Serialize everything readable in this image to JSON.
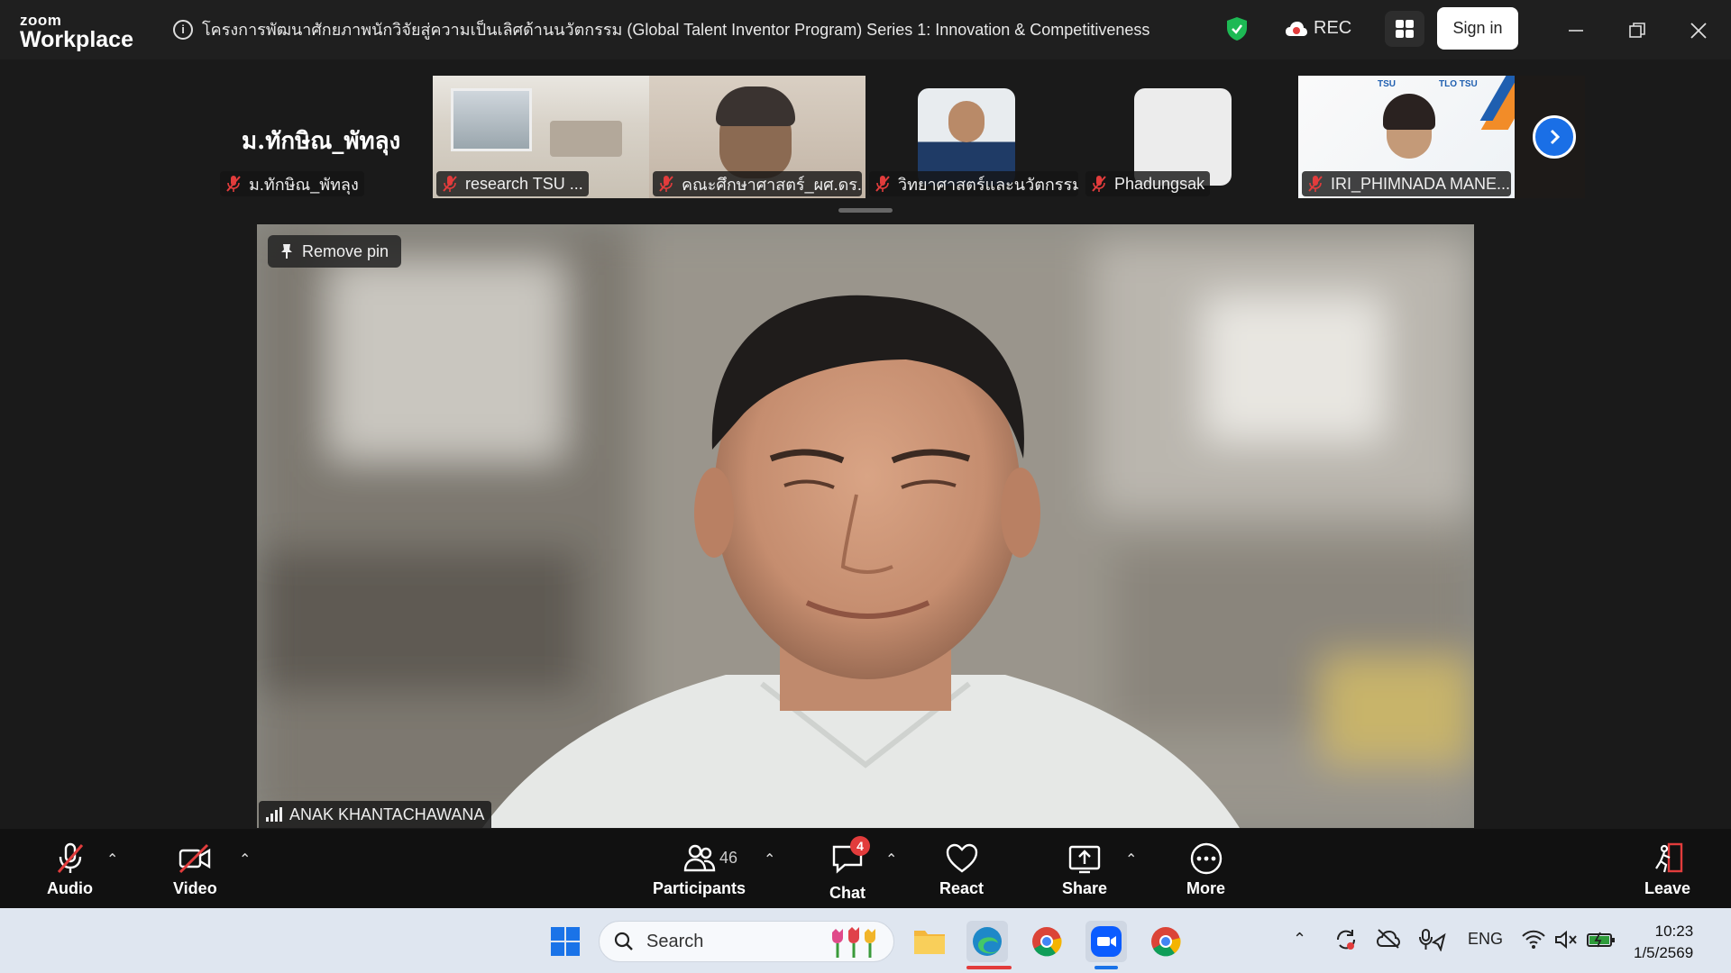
{
  "app": {
    "brand_top": "zoom",
    "brand_bottom": "Workplace",
    "meeting_title": "โครงการพัฒนาศักยภาพนักวิจัยสู่ความเป็นเลิศด้านนวัตกรรม (Global Talent Inventor Program) Series 1: Innovation & Competitiveness",
    "rec_label": "REC",
    "signin_label": "Sign in"
  },
  "gallery": {
    "active_speaker_name": "ม.ทักษิณ_พัทลุง",
    "tiles": [
      {
        "name": "ม.ทักษิณ_พัทลุง",
        "muted": true
      },
      {
        "name": "research TSU ...",
        "muted": true
      },
      {
        "name": "คณะศึกษาศาสตร์_ผศ.ดร....",
        "muted": true
      },
      {
        "name": "วิทยาศาสตร์และนวัตกรรม...",
        "muted": true
      },
      {
        "name": "Phadungsak",
        "muted": true
      },
      {
        "name": "IRI_PHIMNADA MANE...",
        "muted": true
      }
    ],
    "tile5_logo_left": "TSU",
    "tile5_logo_right": "TLO TSU"
  },
  "main_video": {
    "pin_label": "Remove pin",
    "speaker_name": "ANAK KHANTACHAWANA"
  },
  "toolbar": {
    "audio": "Audio",
    "video": "Video",
    "participants": "Participants",
    "participants_count": "46",
    "chat": "Chat",
    "chat_badge": "4",
    "react": "React",
    "share": "Share",
    "more": "More",
    "leave": "Leave"
  },
  "taskbar": {
    "search_placeholder": "Search",
    "lang": "ENG",
    "time": "10:23",
    "date": "1/5/2569"
  },
  "colors": {
    "accent_blue": "#1a6fe6",
    "mute_red": "#e23c3c",
    "shield_green": "#1db954"
  }
}
